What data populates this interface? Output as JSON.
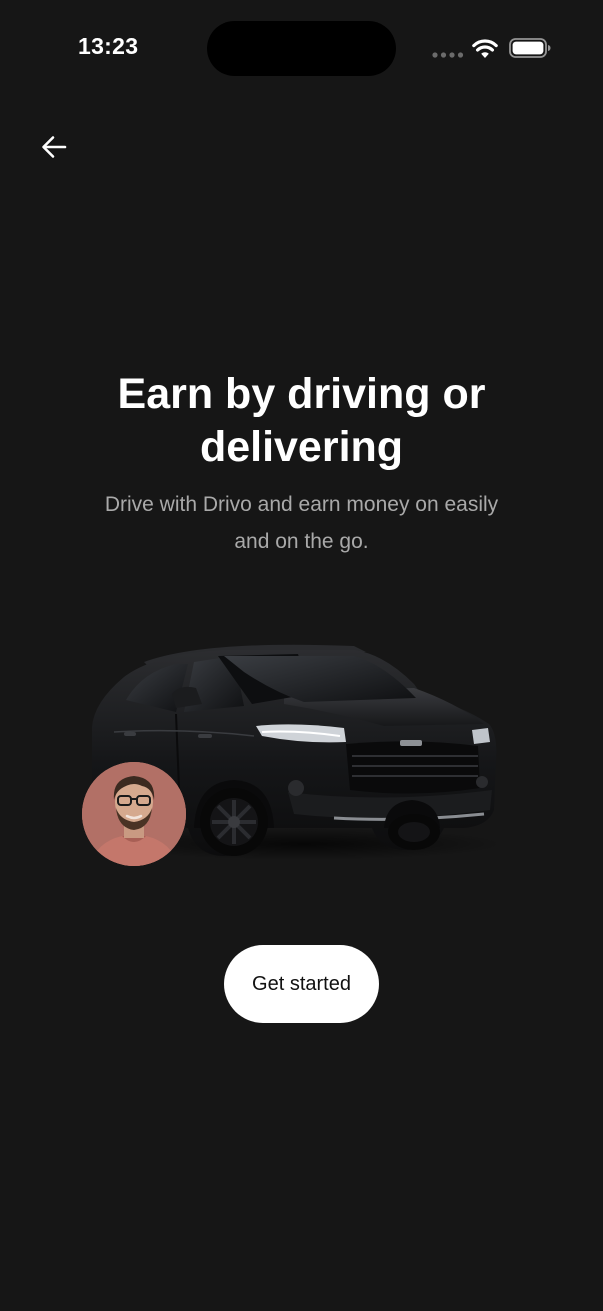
{
  "status_bar": {
    "time": "13:23",
    "signal_icon": "signal-dots-icon",
    "wifi_icon": "wifi-icon",
    "battery_icon": "battery-icon"
  },
  "nav": {
    "back_icon": "arrow-left-icon"
  },
  "hero": {
    "title": "Earn by driving or delivering",
    "subtitle": "Drive with Drivo and earn money on easily and on the go.",
    "illustration": "black-suv-car",
    "avatar": "smiling-man-with-glasses"
  },
  "cta": {
    "label": "Get started"
  },
  "colors": {
    "background": "#161616",
    "title": "#ffffff",
    "subtitle": "#a9a9a9",
    "button_bg": "#ffffff",
    "button_text": "#111111"
  }
}
